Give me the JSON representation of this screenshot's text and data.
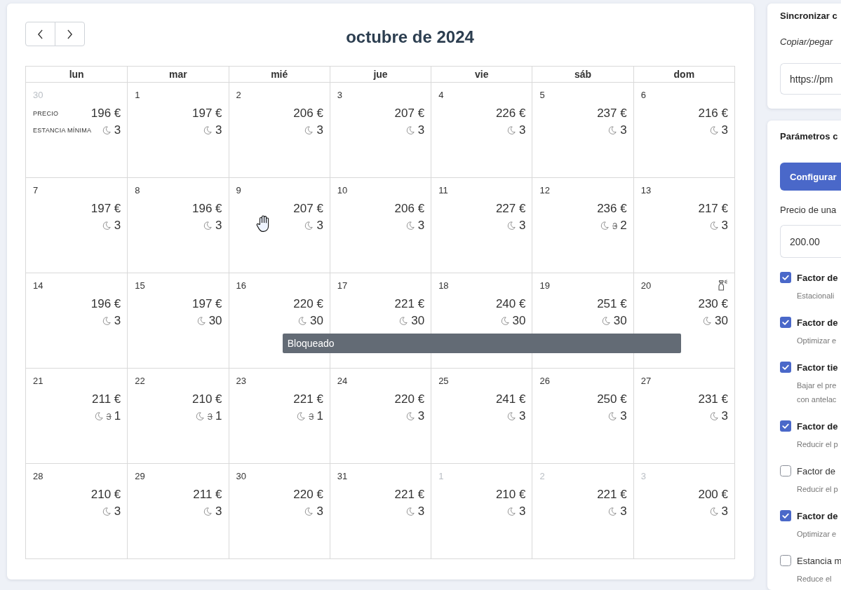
{
  "calendar": {
    "title": "octubre de 2024",
    "weekdays": [
      "lun",
      "mar",
      "mié",
      "jue",
      "vie",
      "sáb",
      "dom"
    ],
    "weeks": [
      {
        "days": [
          {
            "date": "30",
            "other_month": true,
            "price_label": "PRECIO",
            "price": "196 €",
            "stay_label": "ESTANCIA MÍNIMA",
            "stay": "3",
            "blocked": false,
            "cleaning": false
          },
          {
            "date": "1",
            "other_month": false,
            "price": "197 €",
            "stay": "3",
            "blocked": false,
            "cleaning": false
          },
          {
            "date": "2",
            "other_month": false,
            "price": "206 €",
            "stay": "3",
            "blocked": false,
            "cleaning": false
          },
          {
            "date": "3",
            "other_month": false,
            "price": "207 €",
            "stay": "3",
            "blocked": false,
            "cleaning": false
          },
          {
            "date": "4",
            "other_month": false,
            "price": "226 €",
            "stay": "3",
            "blocked": false,
            "cleaning": false
          },
          {
            "date": "5",
            "other_month": false,
            "price": "237 €",
            "stay": "3",
            "blocked": false,
            "cleaning": false
          },
          {
            "date": "6",
            "other_month": false,
            "price": "216 €",
            "stay": "3",
            "blocked": false,
            "cleaning": false
          }
        ]
      },
      {
        "days": [
          {
            "date": "7",
            "other_month": false,
            "price": "197 €",
            "stay": "3",
            "blocked": false,
            "cleaning": false
          },
          {
            "date": "8",
            "other_month": false,
            "price": "196 €",
            "stay": "3",
            "blocked": false,
            "cleaning": false
          },
          {
            "date": "9",
            "other_month": false,
            "price": "207 €",
            "stay": "3",
            "blocked": false,
            "cleaning": false
          },
          {
            "date": "10",
            "other_month": false,
            "price": "206 €",
            "stay": "3",
            "blocked": false,
            "cleaning": false
          },
          {
            "date": "11",
            "other_month": false,
            "price": "227 €",
            "stay": "3",
            "blocked": false,
            "cleaning": false
          },
          {
            "date": "12",
            "other_month": false,
            "price": "236 €",
            "stay_was": "3",
            "stay": "2",
            "blocked": false,
            "cleaning": false
          },
          {
            "date": "13",
            "other_month": false,
            "price": "217 €",
            "stay": "3",
            "blocked": false,
            "cleaning": false
          }
        ]
      },
      {
        "event": "Bloqueado",
        "days": [
          {
            "date": "14",
            "other_month": false,
            "price": "196 €",
            "stay": "3",
            "blocked": false,
            "cleaning": false
          },
          {
            "date": "15",
            "other_month": false,
            "price": "197 €",
            "stay": "30",
            "blocked": false,
            "cleaning": false
          },
          {
            "date": "16",
            "other_month": false,
            "price": "220 €",
            "stay": "30",
            "blocked": true,
            "cleaning": false
          },
          {
            "date": "17",
            "other_month": false,
            "price": "221 €",
            "stay": "30",
            "blocked": true,
            "cleaning": false
          },
          {
            "date": "18",
            "other_month": false,
            "price": "240 €",
            "stay": "30",
            "blocked": true,
            "cleaning": false
          },
          {
            "date": "19",
            "other_month": false,
            "price": "251 €",
            "stay": "30",
            "blocked": true,
            "cleaning": false
          },
          {
            "date": "20",
            "other_month": false,
            "price": "230 €",
            "stay": "30",
            "blocked": true,
            "cleaning": true
          }
        ]
      },
      {
        "days": [
          {
            "date": "21",
            "other_month": false,
            "price": "211 €",
            "stay_was": "3",
            "stay": "1",
            "blocked": false,
            "cleaning": false
          },
          {
            "date": "22",
            "other_month": false,
            "price": "210 €",
            "stay_was": "3",
            "stay": "1",
            "blocked": false,
            "cleaning": false
          },
          {
            "date": "23",
            "other_month": false,
            "price": "221 €",
            "stay_was": "3",
            "stay": "1",
            "blocked": false,
            "cleaning": false
          },
          {
            "date": "24",
            "other_month": false,
            "price": "220 €",
            "stay": "3",
            "blocked": false,
            "cleaning": false
          },
          {
            "date": "25",
            "other_month": false,
            "price": "241 €",
            "stay": "3",
            "blocked": false,
            "cleaning": false
          },
          {
            "date": "26",
            "other_month": false,
            "price": "250 €",
            "stay": "3",
            "blocked": false,
            "cleaning": false
          },
          {
            "date": "27",
            "other_month": false,
            "price": "231 €",
            "stay": "3",
            "blocked": false,
            "cleaning": false
          }
        ]
      },
      {
        "days": [
          {
            "date": "28",
            "other_month": false,
            "price": "210 €",
            "stay": "3",
            "blocked": false,
            "cleaning": false
          },
          {
            "date": "29",
            "other_month": false,
            "price": "211 €",
            "stay": "3",
            "blocked": false,
            "cleaning": false
          },
          {
            "date": "30",
            "other_month": false,
            "price": "220 €",
            "stay": "3",
            "blocked": false,
            "cleaning": false
          },
          {
            "date": "31",
            "other_month": false,
            "price": "221 €",
            "stay": "3",
            "blocked": false,
            "cleaning": false
          },
          {
            "date": "1",
            "other_month": true,
            "price": "210 €",
            "stay": "3",
            "blocked": false,
            "cleaning": false
          },
          {
            "date": "2",
            "other_month": true,
            "price": "221 €",
            "stay": "3",
            "blocked": false,
            "cleaning": false
          },
          {
            "date": "3",
            "other_month": true,
            "price": "200 €",
            "stay": "3",
            "blocked": false,
            "cleaning": false
          }
        ]
      }
    ]
  },
  "sync": {
    "title": "Sincronizar c",
    "hint": "Copiar/pegar",
    "url": "https://pm"
  },
  "parameters": {
    "title": "Parámetros c",
    "button": "Configurar",
    "price_label": "Precio de una",
    "price_value": "200.00",
    "options": [
      {
        "label": "Factor de",
        "checked": true,
        "description": "Estacionali"
      },
      {
        "label": "Factor de",
        "checked": true,
        "description": "Optimizar e"
      },
      {
        "label": "Factor tie",
        "checked": true,
        "description": "Bajar el pre con antelac"
      },
      {
        "label": "Factor de",
        "checked": true,
        "description": "Reducir el p"
      },
      {
        "label": "Factor de",
        "checked": false,
        "description": "Reducir el p"
      },
      {
        "label": "Factor de",
        "checked": true,
        "description": "Optimizar e"
      },
      {
        "label": "Estancia m",
        "checked": false,
        "description": "Reduce el"
      }
    ]
  }
}
